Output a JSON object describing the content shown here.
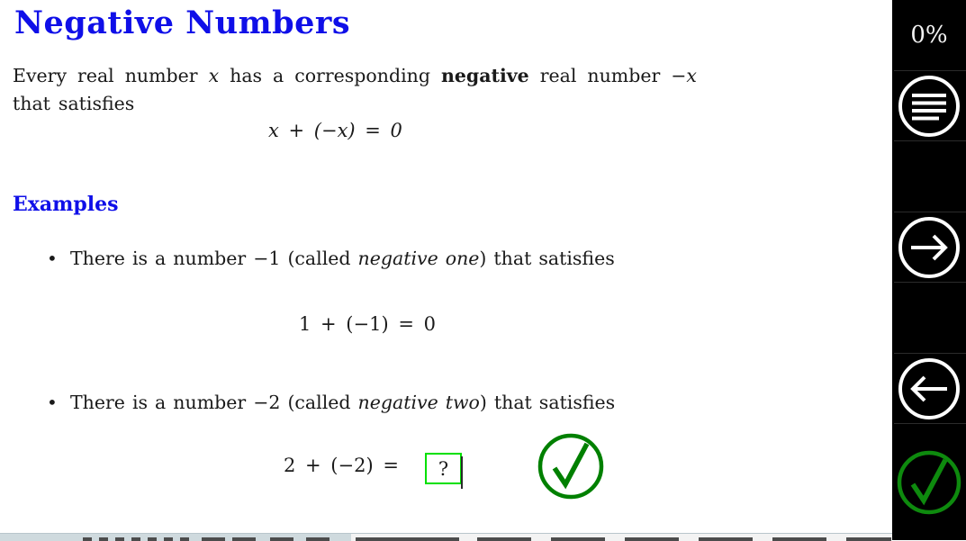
{
  "slide": {
    "title": "Negative Numbers",
    "paragraph": {
      "before": "Every real number ",
      "var1": "x",
      "mid1": " has a corresponding ",
      "bold": "negative",
      "mid2": " real number ",
      "var2": "−x",
      "after": " that satisfies"
    },
    "equation_main": "x + (−x)  =  0",
    "section_heading": "Examples",
    "bullets": [
      {
        "marker": "•",
        "pre": "There is a number −1 (called ",
        "italic": "negative one",
        "post": ") that satisfies",
        "equation": "1 + (−1)  =  0"
      },
      {
        "marker": "•",
        "pre": "There is a number −2 (called ",
        "italic": "negative two",
        "post": ") that satisfies",
        "equation": "2 + (−2)  ="
      }
    ],
    "answer_box": {
      "value": "?",
      "border_color": "#00e000"
    },
    "check_mark": {
      "name": "check-circle",
      "color": "#008000"
    },
    "colors": {
      "heading": "#0f0fe8",
      "body": "#1a1a1a",
      "background": "#ffffff"
    }
  },
  "sidebar": {
    "background": "#000000",
    "progress_label": "0%",
    "buttons": [
      {
        "icon": "text-lines-circle-icon",
        "label": "Contents"
      },
      {
        "icon": "blank-slot",
        "label": ""
      },
      {
        "icon": "arrow-right-circle-icon",
        "label": "Next"
      },
      {
        "icon": "blank-slot",
        "label": ""
      },
      {
        "icon": "arrow-left-circle-icon",
        "label": "Previous"
      },
      {
        "icon": "check-circle-icon",
        "label": "Check"
      }
    ],
    "check_color": "#0e8a0e",
    "icon_color": "#ffffff"
  }
}
